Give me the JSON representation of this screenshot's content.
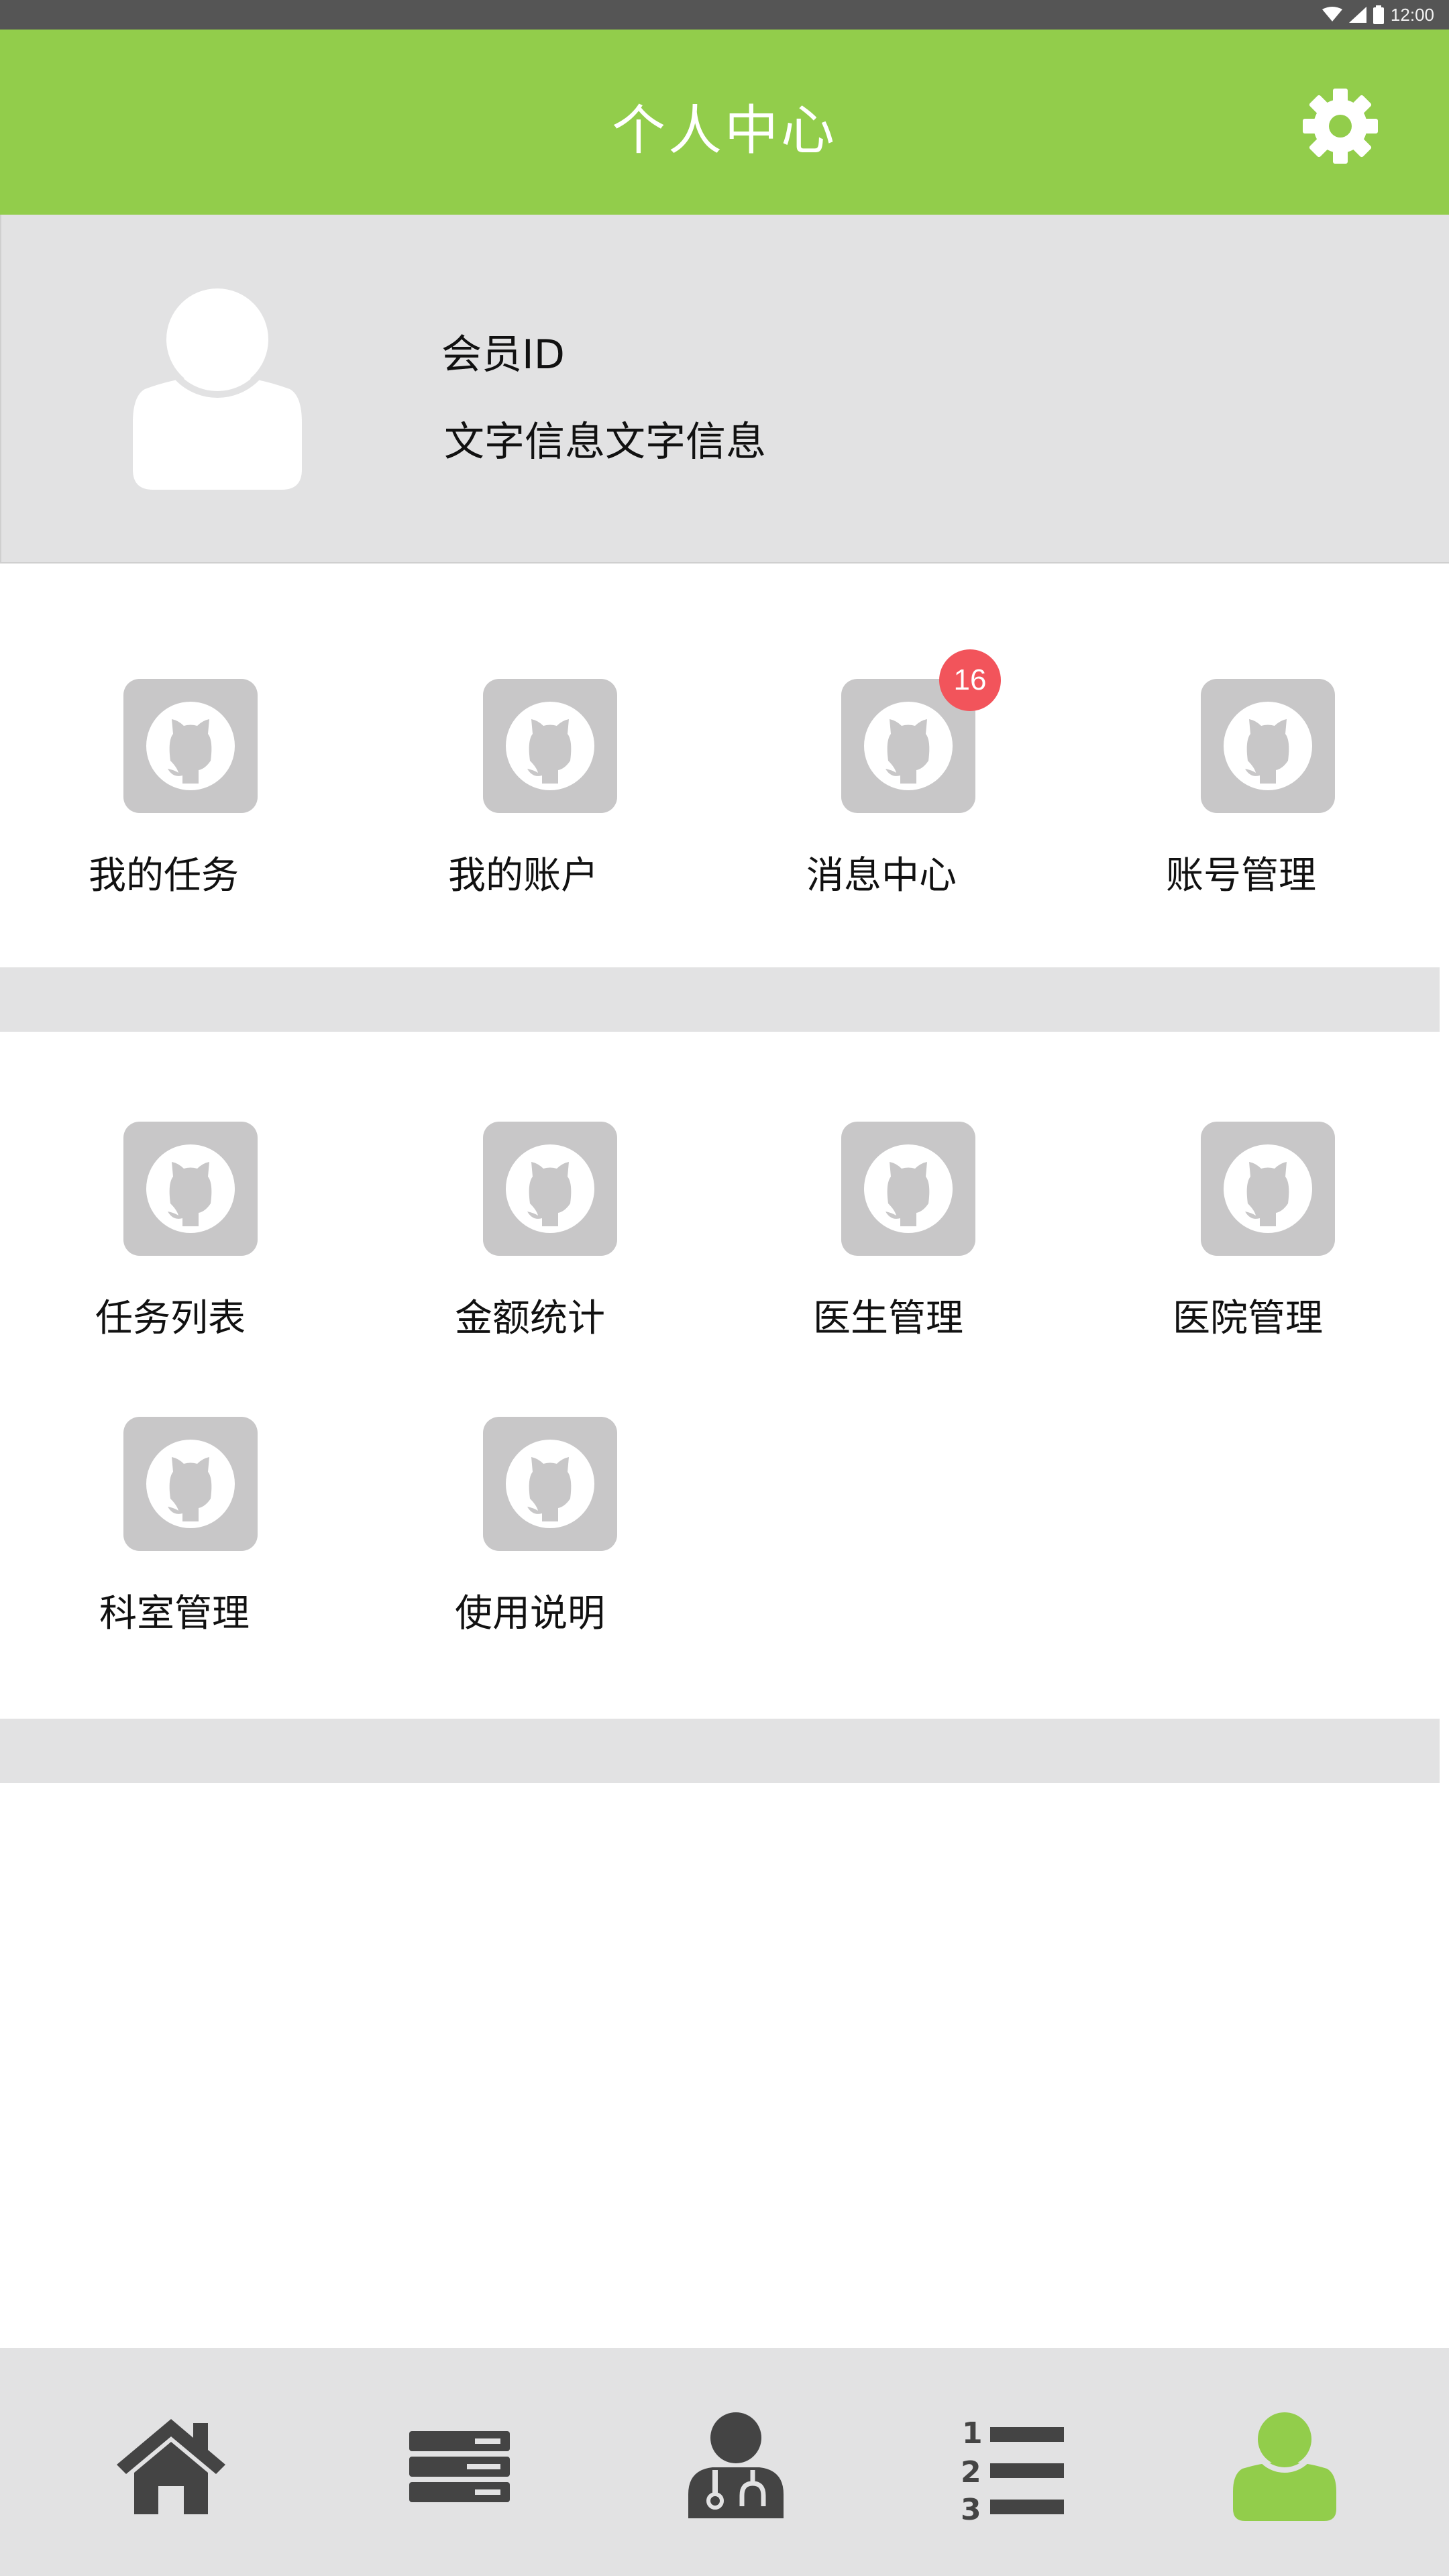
{
  "status_bar": {
    "time": "12:00",
    "icons": [
      "wifi-icon",
      "cell-signal-icon",
      "battery-icon"
    ]
  },
  "header": {
    "title": "个人中心",
    "settings_icon": "gear-icon"
  },
  "profile": {
    "avatar_icon": "user-avatar-icon",
    "member_id": "会员ID",
    "description": "文字信息文字信息"
  },
  "section1": {
    "items": [
      {
        "label": "我的任务",
        "icon": "github-cat-icon"
      },
      {
        "label": "我的账户",
        "icon": "github-cat-icon"
      },
      {
        "label": "消息中心",
        "icon": "github-cat-icon",
        "badge": "16"
      },
      {
        "label": "账号管理",
        "icon": "github-cat-icon"
      }
    ]
  },
  "section2": {
    "items": [
      {
        "label": "任务列表",
        "icon": "github-cat-icon"
      },
      {
        "label": "金额统计",
        "icon": "github-cat-icon"
      },
      {
        "label": "医生管理",
        "icon": "github-cat-icon"
      },
      {
        "label": "医院管理",
        "icon": "github-cat-icon"
      },
      {
        "label": "科室管理",
        "icon": "github-cat-icon"
      },
      {
        "label": "使用说明",
        "icon": "github-cat-icon"
      }
    ]
  },
  "bottom_nav": {
    "items": [
      {
        "icon": "home-icon",
        "active": false
      },
      {
        "icon": "server-list-icon",
        "active": false
      },
      {
        "icon": "doctor-icon",
        "active": false
      },
      {
        "icon": "numbered-list-icon",
        "active": false
      },
      {
        "icon": "user-icon",
        "active": true
      }
    ]
  },
  "colors": {
    "accent": "#92cd4b",
    "badge": "#f2545b",
    "tile": "#c8c7c8",
    "nav_icon": "#444444",
    "panel": "#e2e2e3"
  }
}
